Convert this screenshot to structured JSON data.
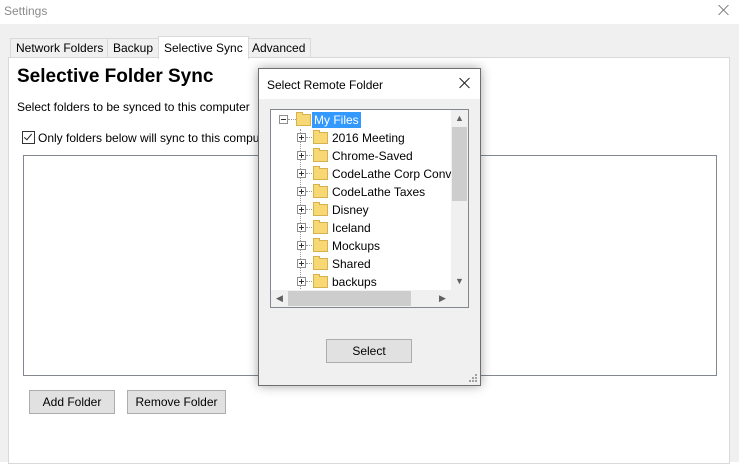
{
  "window": {
    "title": "Settings"
  },
  "tabs": [
    {
      "label": "Network Folders"
    },
    {
      "label": "Backup"
    },
    {
      "label": "Selective Sync"
    },
    {
      "label": "Advanced"
    }
  ],
  "page": {
    "heading": "Selective Folder Sync",
    "subtitle": "Select folders to be synced to this computer",
    "checkbox_label": "Only folders below will sync to this compu",
    "add_button": "Add Folder",
    "remove_button": "Remove Folder"
  },
  "dialog": {
    "title": "Select Remote Folder",
    "root": "My Files",
    "folders": [
      "2016 Meeting",
      "Chrome-Saved",
      "CodeLathe Corp Conv",
      "CodeLathe Taxes",
      "Disney",
      "Iceland",
      "Mockups",
      "Shared",
      "backups"
    ],
    "select_button": "Select"
  },
  "icons": {
    "window_close": "close-icon",
    "dialog_close": "close-icon",
    "folder": "folder-icon",
    "expand": "plus-box-icon",
    "collapse": "minus-box-icon"
  },
  "colors": {
    "selection": "#3399ff",
    "folder": "#f8d775"
  }
}
